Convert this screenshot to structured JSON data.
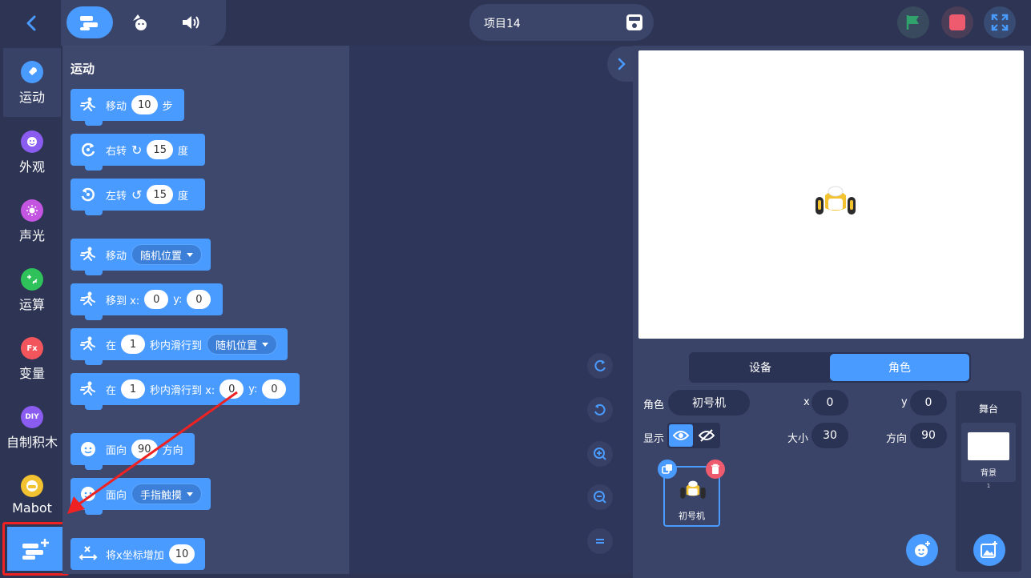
{
  "header": {
    "project_name": "项目14",
    "tabs": [
      {
        "name": "code-tab",
        "icon": "code-blocks-icon",
        "active": true
      },
      {
        "name": "costumes-tab",
        "icon": "costume-icon",
        "active": false
      },
      {
        "name": "sounds-tab",
        "icon": "speaker-icon",
        "active": false
      }
    ]
  },
  "categories": [
    {
      "label": "运动",
      "color": "#4a9bff",
      "icon": "rocket-icon",
      "text": "",
      "active": true
    },
    {
      "label": "外观",
      "color": "#8a5cf0",
      "icon": "smiley-icon",
      "text": "",
      "active": false
    },
    {
      "label": "声光",
      "color": "#c455e0",
      "icon": "light-icon",
      "text": "",
      "active": false
    },
    {
      "label": "运算",
      "color": "#2fc15a",
      "icon": "operators-icon",
      "text": "",
      "active": false
    },
    {
      "label": "变量",
      "color": "#f2555b",
      "icon": "fx-icon",
      "text": "Fx",
      "active": false
    },
    {
      "label": "自制积木",
      "color": "#8a5cf0",
      "icon": "diy-icon",
      "text": "DIY",
      "active": false
    },
    {
      "label": "Mabot",
      "color": "#f2c230",
      "icon": "mabot-icon",
      "text": "",
      "active": false
    }
  ],
  "palette": {
    "title": "运动",
    "blocks": {
      "move": {
        "label": "移动",
        "value": "10",
        "suffix": "步"
      },
      "turn_right": {
        "label": "右转",
        "value": "15",
        "suffix": "度"
      },
      "turn_left": {
        "label": "左转",
        "value": "15",
        "suffix": "度"
      },
      "goto_random": {
        "label": "移动",
        "option": "随机位置"
      },
      "goto_xy": {
        "label": "移到 x:",
        "x": "0",
        "y_label": "y:",
        "y": "0"
      },
      "glide_random": {
        "label": "在",
        "secs": "1",
        "mid": "秒内滑行到",
        "option": "随机位置"
      },
      "glide_xy": {
        "label": "在",
        "secs": "1",
        "mid": "秒内滑行到 x:",
        "x": "0",
        "y_label": "y:",
        "y": "0"
      },
      "point_dir": {
        "label": "面向",
        "value": "90",
        "suffix": "方向"
      },
      "point_towards": {
        "label": "面向",
        "option": "手指触摸"
      },
      "change_x": {
        "label": "将x坐标增加",
        "value": "10"
      }
    }
  },
  "stage": {
    "toggle": {
      "device": "设备",
      "sprite": "角色"
    },
    "props": {
      "sprite_label": "角色",
      "sprite_name": "初号机",
      "x_label": "x",
      "x": "0",
      "y_label": "y",
      "y": "0",
      "show_label": "显示",
      "size_label": "大小",
      "size": "30",
      "dir_label": "方向",
      "dir": "90"
    },
    "sprite_card_name": "初号机",
    "stage_panel": {
      "title": "舞台",
      "backdrop_label": "背景",
      "backdrop_count": "1"
    }
  },
  "colors": {
    "accent": "#4a9bff",
    "green_flag": "#2fa36b",
    "stop": "#ef5b6e",
    "highlight": "#ee2222"
  }
}
